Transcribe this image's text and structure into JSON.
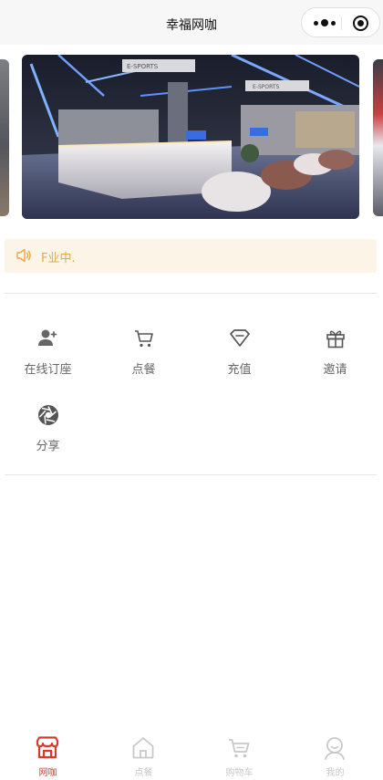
{
  "header": {
    "title": "幸福网咖",
    "more_icon": "more-dots-icon",
    "close_icon": "target-close-icon"
  },
  "banner": {
    "slides": [
      {
        "sign_left": "E-SPORTS",
        "sign_right": "E-SPORTS"
      }
    ]
  },
  "notice": {
    "icon": "speaker-icon",
    "text": "F业中."
  },
  "menu": {
    "items": [
      {
        "label": "在线订座",
        "icon": "add-user-icon"
      },
      {
        "label": "点餐",
        "icon": "cart-icon"
      },
      {
        "label": "充值",
        "icon": "diamond-icon"
      },
      {
        "label": "邀请",
        "icon": "gift-icon"
      },
      {
        "label": "分享",
        "icon": "aperture-icon"
      }
    ]
  },
  "tabbar": {
    "items": [
      {
        "label": "网咖",
        "icon": "store-icon",
        "active": true
      },
      {
        "label": "点餐",
        "icon": "home-icon",
        "active": false
      },
      {
        "label": "购物车",
        "icon": "cart-icon",
        "active": false
      },
      {
        "label": "我的",
        "icon": "user-icon",
        "active": false
      }
    ]
  },
  "colors": {
    "accent": "#d93a2e",
    "notice_bg": "#fdf4e8",
    "notice_text": "#e8a64f",
    "icon_gray": "#666666",
    "tab_inactive": "#c8c8c8"
  }
}
